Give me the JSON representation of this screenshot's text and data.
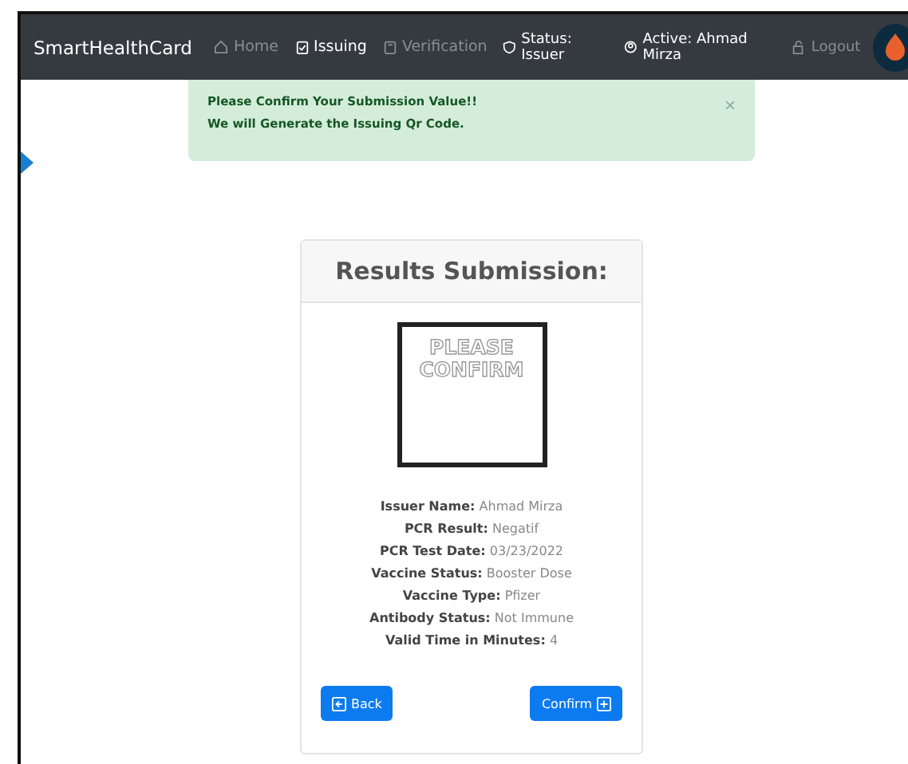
{
  "navbar": {
    "brand": "SmartHealthCard",
    "links": [
      {
        "label": "Home",
        "selected": false
      },
      {
        "label": "Issuing",
        "selected": true
      },
      {
        "label": "Verification",
        "selected": false
      }
    ],
    "status": "Status: Issuer",
    "active_user": "Active: Ahmad Mirza",
    "logout": "Logout"
  },
  "alert": {
    "lines": [
      "Please Confirm Your Submission Value!!",
      "We will Generate the Issuing Qr Code."
    ],
    "close": "×"
  },
  "card": {
    "title": "Results Submission:",
    "qr_text": [
      "PLEASE",
      "CONFIRM"
    ],
    "details": [
      {
        "label": "Issuer Name:",
        "value": "Ahmad Mirza"
      },
      {
        "label": "PCR Result:",
        "value": "Negatif"
      },
      {
        "label": "PCR Test Date:",
        "value": "03/23/2022"
      },
      {
        "label": "Vaccine Status:",
        "value": "Booster Dose"
      },
      {
        "label": "Vaccine Type:",
        "value": "Pfizer"
      },
      {
        "label": "Antibody Status:",
        "value": "Not Immune"
      },
      {
        "label": "Valid Time in Minutes:",
        "value": "4"
      }
    ],
    "buttons": {
      "back": "Back",
      "confirm": "Confirm"
    }
  }
}
